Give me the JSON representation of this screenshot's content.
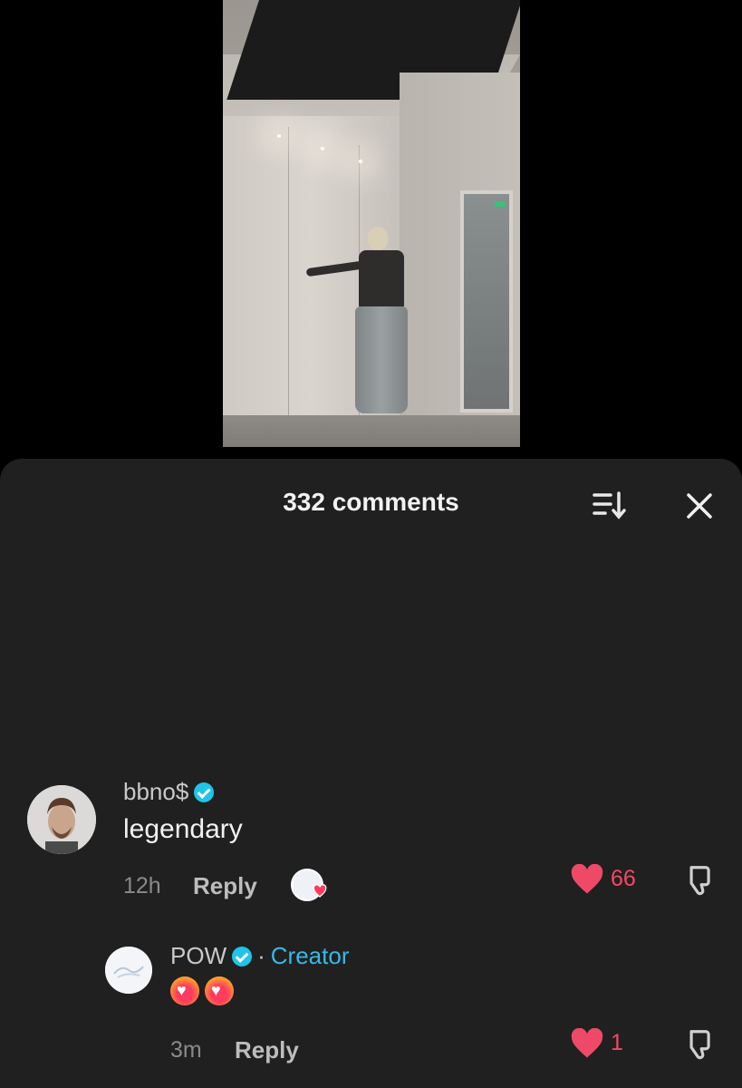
{
  "sheet": {
    "title": "332 comments"
  },
  "comments": [
    {
      "username": "bbno$",
      "text": "legendary",
      "time": "12h",
      "reply_label": "Reply",
      "likes": "66"
    },
    {
      "username": "POW",
      "badge_sep": "·",
      "badge": "Creator",
      "time": "3m",
      "reply_label": "Reply",
      "likes": "1"
    }
  ],
  "colors": {
    "sheet_bg": "#202020",
    "like_red": "#ee4a68",
    "verified_blue": "#20c4e8",
    "creator_blue": "#37b8e6"
  },
  "icons": [
    "sort-icon",
    "close-icon",
    "verified-icon",
    "heart-icon",
    "dislike-icon",
    "fire-heart-emoji"
  ]
}
